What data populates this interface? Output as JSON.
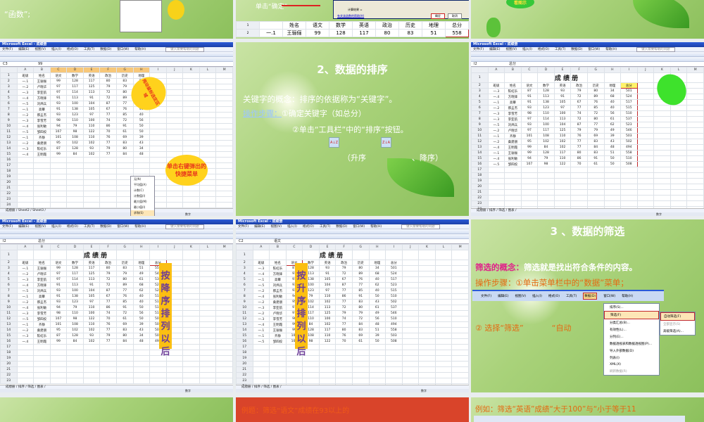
{
  "columns_letters": [
    "A",
    "B",
    "C",
    "D",
    "E",
    "F",
    "G",
    "H",
    "I",
    "J",
    "K",
    "L",
    "M"
  ],
  "headers": [
    "班级",
    "姓名",
    "语文",
    "数学",
    "英语",
    "政治",
    "历史",
    "地理",
    "总分"
  ],
  "records": [
    [
      "一.1",
      "王骊俪",
      "99",
      "128",
      "117",
      "80",
      "83",
      "51",
      "558"
    ],
    [
      "一.2",
      "卢晓华",
      "97",
      "117",
      "125",
      "79",
      "79",
      "49",
      "546"
    ],
    [
      "一.3",
      "李亚航",
      "97",
      "114",
      "113",
      "72",
      "80",
      "61",
      "537"
    ],
    [
      "一.4",
      "方晓锋",
      "91",
      "113",
      "91",
      "72",
      "89",
      "68",
      "524"
    ],
    [
      "一.5",
      "刘炜兵",
      "93",
      "100",
      "104",
      "87",
      "77",
      "62",
      "523"
    ],
    [
      "一.1",
      "高攀",
      "91",
      "138",
      "105",
      "67",
      "76",
      "40",
      "517"
    ],
    [
      "一.2",
      "郝孟杰",
      "93",
      "123",
      "97",
      "77",
      "85",
      "40",
      "515"
    ],
    [
      "一.4",
      "张利敏",
      "94",
      "79",
      "110",
      "86",
      "91",
      "50",
      "510"
    ],
    [
      "一.3",
      "李雪芳",
      "98",
      "110",
      "100",
      "74",
      "72",
      "56",
      "510"
    ],
    [
      "一.5",
      "邹四姣",
      "107",
      "98",
      "122",
      "70",
      "61",
      "50",
      "508"
    ],
    [
      "一.1",
      "齐静",
      "101",
      "108",
      "110",
      "76",
      "69",
      "39",
      "503"
    ],
    [
      "一.2",
      "桑建朋",
      "95",
      "102",
      "102",
      "77",
      "83",
      "43",
      "502"
    ],
    [
      "一.3",
      "陈虹乐",
      "87",
      "128",
      "93",
      "79",
      "80",
      "34",
      "501"
    ],
    [
      "一.4",
      "王明霞",
      "99",
      "84",
      "102",
      "77",
      "84",
      "48",
      "494"
    ]
  ],
  "excel": {
    "app_title": "Microsoft Excel - 成绩册",
    "menu": [
      "文件(F)",
      "编辑(E)",
      "视图(V)",
      "插入(I)",
      "格式(O)",
      "工具(T)",
      "数据(D)",
      "窗口(W)",
      "帮助(H)"
    ],
    "help_placeholder": "键入需要帮助的问题",
    "sheet_title": "成 绩 册",
    "status_text": "数字"
  },
  "top": {
    "slide1_text": "“函数”;",
    "slide2_text": "单击“确定”",
    "slide2_ok": "确定",
    "slide2_cancel": "取消",
    "slide2_result": "计算结果 =",
    "slide2_help": "有关该函数的帮助(H)",
    "slide3_bubble": "看图示"
  },
  "slide_unsorted": {
    "order": [
      0,
      1,
      2,
      3,
      4,
      5,
      6,
      8,
      7,
      9,
      10,
      11,
      12,
      13
    ],
    "cell_ref": "C3",
    "formula": "99",
    "callout1": "拖动鼠标选定区域",
    "callout2": "单击右键弹出的快捷菜单",
    "context_menu": [
      "无(N)",
      "平均值(A)",
      "计数(C)",
      "计数值(I)",
      "最大值(M)",
      "最小值(I)",
      "求和(S)"
    ],
    "tabs": "成绩册 / Sheet2 / Sheet3 /"
  },
  "slide_sort": {
    "title": "2、数据的排序",
    "concept": "关键字的概念：排序的依据称为“关键字”。",
    "step_label": "操作步骤：",
    "step1": "①确定关键字（如总分）",
    "step2": "②单击“工具栏”中的“排序”按钮。",
    "asc": "（升序",
    "desc": "、降序）",
    "asc_icon": "A↓Z",
    "desc_icon": "Z↓A"
  },
  "slide_sel": {
    "order": [
      12,
      3,
      5,
      6,
      8,
      2,
      4,
      1,
      10,
      11,
      13,
      0,
      7,
      9
    ],
    "cell_ref": "I2",
    "formula": "总分",
    "tabs": "成绩册 / 排序 / 筛选 / 图表 /"
  },
  "slide_desc": {
    "order": [
      0,
      1,
      2,
      3,
      4,
      5,
      6,
      7,
      8,
      9,
      10,
      11,
      12,
      13
    ],
    "cell_ref": "I2",
    "formula": "总分",
    "label": "按降序排列以后",
    "tabs": "成绩册 / 排序 / 筛选 / 图表 /"
  },
  "slide_asc": {
    "order": [
      12,
      3,
      5,
      4,
      6,
      7,
      11,
      2,
      1,
      8,
      13,
      0,
      10,
      9
    ],
    "cell_ref": "C2",
    "formula": "语文",
    "label": "按升序排列以后",
    "tabs": "成绩册 / 排序 / 筛选 / 图表 /"
  },
  "slide_filter": {
    "title": "3 、数据的筛选",
    "concept_label": "筛选的概念：",
    "concept": "筛选就是找出符合条件的内容。",
    "step1": "操作步骤：①单击菜单栏中的“数据”菜单；",
    "step2": "② 选择“筛选”",
    "step2b": "“自动",
    "data_menu": [
      "排序(S)...",
      "筛选(F)",
      "分类汇总(B)...",
      "有效性(L)...",
      "分列(E)...",
      "数据透视表和数据透视图(P)...",
      "导入外部数据(D)",
      "列表(I)",
      "XML(X)",
      "刷新数据(R)"
    ],
    "sub_menu": [
      "自动筛选(F)",
      "全部显示(S)",
      "高级筛选(A)..."
    ]
  },
  "bottom": {
    "red_text": "例题：筛选“语文”成绩在93以上的",
    "right_text": "例如：筛选“英语”成绩“大于100”与“小于等于11"
  },
  "colors": {
    "green": "#a9d27a",
    "red_accent": "#c0282d",
    "callout_yellow": "#ffd21c",
    "excel_blue": "#2b5bd8"
  }
}
